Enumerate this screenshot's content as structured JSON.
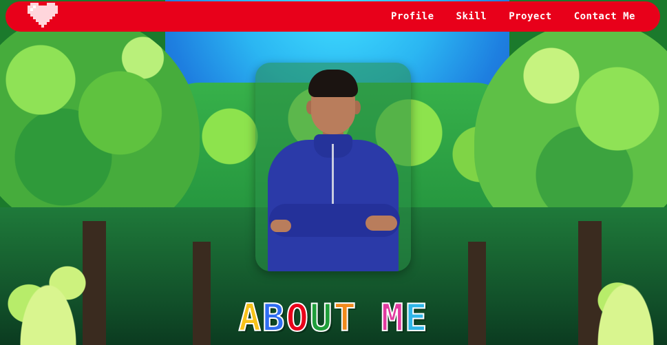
{
  "nav": {
    "logo_icon": "pixel-heart-icon",
    "links": [
      {
        "label": "Profile"
      },
      {
        "label": "Skill"
      },
      {
        "label": "Proyect"
      },
      {
        "label": "Contact Me"
      }
    ],
    "background_color": "#e8001a"
  },
  "hero": {
    "photo": "profile-photo"
  },
  "about": {
    "heading_letters": [
      {
        "char": "A",
        "color": "#f7c21a"
      },
      {
        "char": "B",
        "color": "#2f6df2"
      },
      {
        "char": "O",
        "color": "#e8001a"
      },
      {
        "char": "U",
        "color": "#1f9e3a"
      },
      {
        "char": "T",
        "color": "#f08a1c"
      },
      {
        "char": " ",
        "color": "#ffffff"
      },
      {
        "char": "M",
        "color": "#e23aa0"
      },
      {
        "char": "E",
        "color": "#2fb6e8"
      }
    ]
  }
}
